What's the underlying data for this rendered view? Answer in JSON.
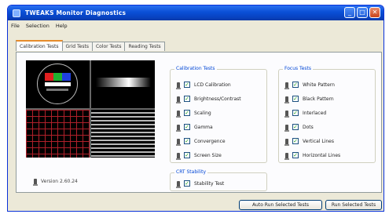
{
  "window": {
    "title": "TWEAKS Monitor Diagnostics"
  },
  "menu": [
    "File",
    "Selection",
    "Help"
  ],
  "tabs": [
    "Calibration Tests",
    "Grid Tests",
    "Color Tests",
    "Reading Tests"
  ],
  "version": "Version 2.60.24",
  "calibration": {
    "title": "Calibration Tests",
    "items": [
      "LCD Calibration",
      "Brightness/Contrast",
      "Scaling",
      "Gamma",
      "Convergence",
      "Screen Size"
    ]
  },
  "focus": {
    "title": "Focus Tests",
    "items": [
      "White Pattern",
      "Black Pattern",
      "Interlaced",
      "Dots",
      "Vertical Lines",
      "Horizontal Lines"
    ]
  },
  "crt": {
    "title": "CRT Stability",
    "items": [
      "Stability Test"
    ]
  },
  "buttons": {
    "auto_run": "Auto Run Selected Tests",
    "run": "Run Selected Tests"
  },
  "check_mark": "✓",
  "colors": {
    "title_bar": "#0a4fd6",
    "group_title": "#0046d5",
    "accent_tab": "#e68b2c"
  }
}
